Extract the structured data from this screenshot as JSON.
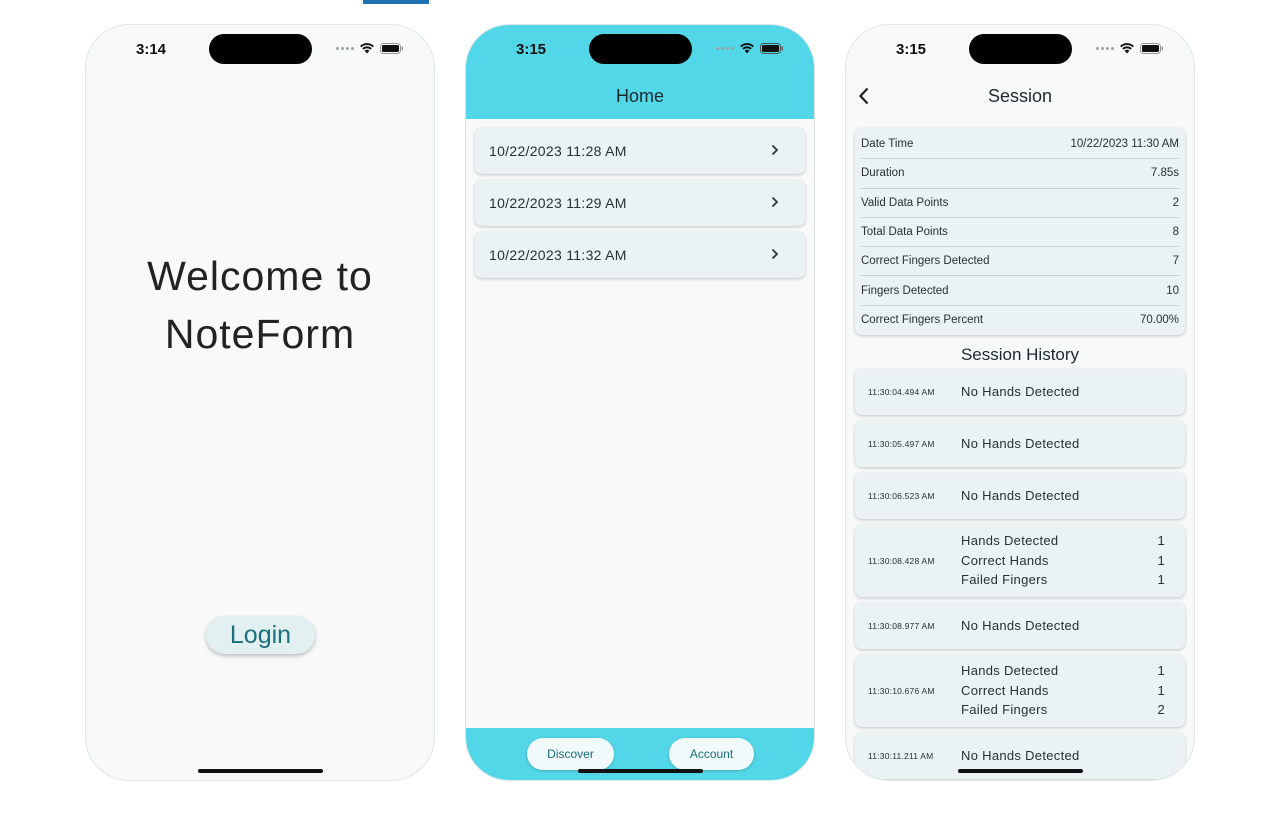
{
  "screen1": {
    "time": "3:14",
    "welcome_line1": "Welcome to",
    "welcome_line2": "NoteForm",
    "login_label": "Login"
  },
  "screen2": {
    "time": "3:15",
    "title": "Home",
    "sessions": [
      {
        "label": "10/22/2023 11:28 AM"
      },
      {
        "label": "10/22/2023 11:29 AM"
      },
      {
        "label": "10/22/2023 11:32 AM"
      }
    ],
    "nav": {
      "discover": "Discover",
      "account": "Account"
    }
  },
  "screen3": {
    "time": "3:15",
    "title": "Session",
    "details": [
      {
        "label": "Date Time",
        "value": "10/22/2023 11:30 AM"
      },
      {
        "label": "Duration",
        "value": "7.85s"
      },
      {
        "label": "Valid Data Points",
        "value": "2"
      },
      {
        "label": "Total Data Points",
        "value": "8"
      },
      {
        "label": "Correct Fingers Detected",
        "value": "7"
      },
      {
        "label": "Fingers Detected",
        "value": "10"
      },
      {
        "label": "Correct Fingers Percent",
        "value": "70.00%"
      }
    ],
    "history_title": "Session History",
    "history": [
      {
        "time": "11:30:04.494 AM",
        "message": "No Hands Detected"
      },
      {
        "time": "11:30:05.497 AM",
        "message": "No Hands Detected"
      },
      {
        "time": "11:30:06.523 AM",
        "message": "No Hands Detected"
      },
      {
        "time": "11:30:08.428 AM",
        "stats": [
          {
            "label": "Hands Detected",
            "value": "1"
          },
          {
            "label": "Correct Hands",
            "value": "1"
          },
          {
            "label": "Failed Fingers",
            "value": "1"
          }
        ]
      },
      {
        "time": "11:30:08.977 AM",
        "message": "No Hands Detected"
      },
      {
        "time": "11:30:10.676 AM",
        "stats": [
          {
            "label": "Hands Detected",
            "value": "1"
          },
          {
            "label": "Correct Hands",
            "value": "1"
          },
          {
            "label": "Failed Fingers",
            "value": "2"
          }
        ]
      },
      {
        "time": "11:30:11.211 AM",
        "message": "No Hands Detected"
      }
    ]
  },
  "colors": {
    "header": "#52d7e9",
    "accent_text": "#17707a",
    "card": "#eaf2f3",
    "background": "#f8fafa"
  }
}
